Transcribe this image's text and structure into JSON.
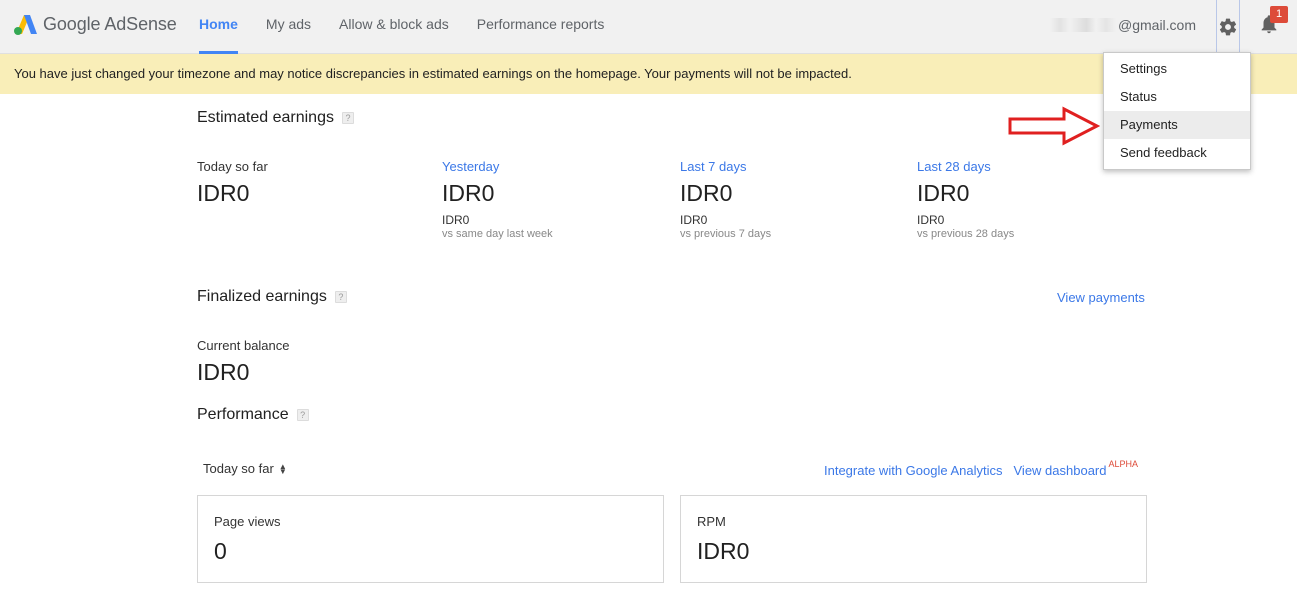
{
  "header": {
    "brand": "Google AdSense",
    "nav": [
      {
        "label": "Home",
        "active": true
      },
      {
        "label": "My ads",
        "active": false
      },
      {
        "label": "Allow & block ads",
        "active": false
      },
      {
        "label": "Performance reports",
        "active": false
      }
    ],
    "account_email_suffix": "@gmail.com",
    "notification_count": "1",
    "icons": {
      "settings": "gear-icon",
      "notifications": "bell-icon"
    }
  },
  "banner": {
    "text": "You have just changed your timezone and may notice discrepancies in estimated earnings on the homepage. Your payments will not be impacted."
  },
  "settings_menu": {
    "items": [
      "Settings",
      "Status",
      "Payments",
      "Send feedback"
    ],
    "highlighted": "Payments"
  },
  "estimated_earnings": {
    "title": "Estimated earnings",
    "help": "?",
    "periods": [
      {
        "label": "Today so far",
        "value": "IDR0",
        "compare_value": "",
        "compare_text": ""
      },
      {
        "label": "Yesterday",
        "value": "IDR0",
        "compare_value": "IDR0",
        "compare_text": "vs same day last week"
      },
      {
        "label": "Last 7 days",
        "value": "IDR0",
        "compare_value": "IDR0",
        "compare_text": "vs previous 7 days"
      },
      {
        "label": "Last 28 days",
        "value": "IDR0",
        "compare_value": "IDR0",
        "compare_text": "vs previous 28 days"
      }
    ]
  },
  "finalized_earnings": {
    "title": "Finalized earnings",
    "help": "?",
    "view_payments": "View payments",
    "balance_label": "Current balance",
    "balance_value": "IDR0"
  },
  "performance": {
    "title": "Performance",
    "help": "?",
    "range": "Today so far",
    "integrate_link": "Integrate with Google Analytics",
    "dashboard_link": "View dashboard",
    "dashboard_badge": "ALPHA",
    "cards": [
      {
        "label": "Page views",
        "value": "0"
      },
      {
        "label": "RPM",
        "value": "IDR0"
      }
    ]
  },
  "colors": {
    "accent": "#4285f4",
    "link": "#3b78e7",
    "banner": "#f9eeb8",
    "badge": "#dd4b39",
    "arrow": "#e02020"
  }
}
